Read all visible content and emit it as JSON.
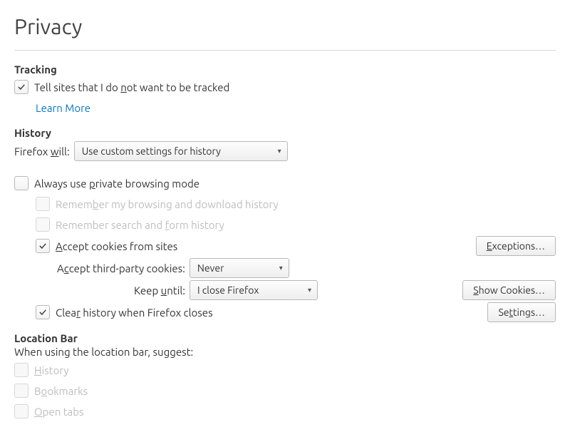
{
  "pageTitle": "Privacy",
  "tracking": {
    "title": "Tracking",
    "doNotTrack": {
      "checked": true,
      "label_pre": "Tell sites that I do ",
      "label_u": "n",
      "label_post": "ot want to be tracked"
    },
    "learnMore": "Learn More"
  },
  "history": {
    "title": "History",
    "firefoxWillPre": "Firefox ",
    "firefoxWillU": "w",
    "firefoxWillPost": "ill:",
    "modeSelected": "Use custom settings for history",
    "privateMode": {
      "checked": false,
      "label_pre": "Always use ",
      "label_u": "p",
      "label_post": "rivate browsing mode"
    },
    "remBrowsing": {
      "checked": false,
      "disabled": true,
      "label_pre": "Remem",
      "label_u": "b",
      "label_post": "er my browsing and download history"
    },
    "remSearch": {
      "checked": false,
      "disabled": true,
      "label_pre": "Remember search and ",
      "label_u": "f",
      "label_post": "orm history"
    },
    "acceptCookies": {
      "checked": true,
      "label_pre": "",
      "label_u": "A",
      "label_post": "ccept cookies from sites"
    },
    "exceptionsBtn": {
      "pre": "",
      "u": "E",
      "post": "xceptions…"
    },
    "thirdParty": {
      "label_pre": "A",
      "label_u": "c",
      "label_post": "cept third-party cookies:",
      "selected": "Never"
    },
    "keepUntil": {
      "label_pre": "Keep ",
      "label_u": "u",
      "label_post": "ntil:",
      "selected": "I close Firefox"
    },
    "showCookiesBtn": {
      "pre": "",
      "u": "S",
      "post": "how Cookies…"
    },
    "clearOnClose": {
      "checked": true,
      "label_pre": "Clea",
      "label_u": "r",
      "label_post": " history when Firefox closes"
    },
    "settingsBtn": {
      "pre": "Se",
      "u": "t",
      "post": "tings…"
    }
  },
  "locationBar": {
    "title": "Location Bar",
    "subtext": "When using the location bar, suggest:",
    "historyOpt": {
      "checked": false,
      "disabled": true,
      "label_pre": "",
      "label_u": "H",
      "label_post": "istory"
    },
    "bookmarksOpt": {
      "checked": false,
      "disabled": true,
      "label_pre": "B",
      "label_u": "o",
      "label_post": "okmarks"
    },
    "openTabsOpt": {
      "checked": false,
      "disabled": true,
      "label_pre": "",
      "label_u": "O",
      "label_post": "pen tabs"
    }
  }
}
